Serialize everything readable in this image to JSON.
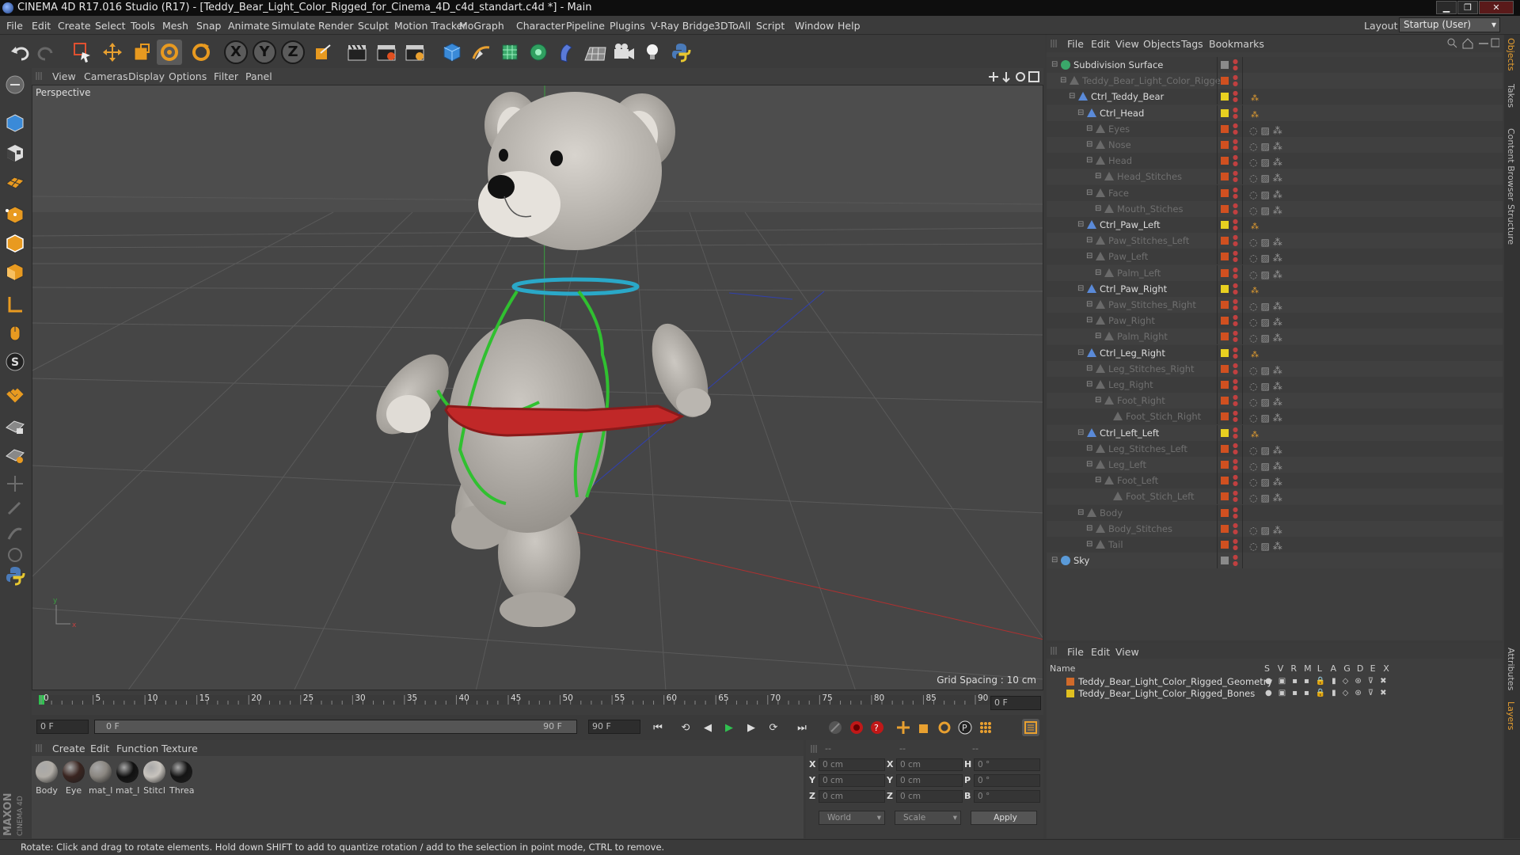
{
  "window": {
    "title": "CINEMA 4D R17.016 Studio (R17) - [Teddy_Bear_Light_Color_Rigged_for_Cinema_4D_c4d_standart.c4d *] - Main"
  },
  "menu": [
    "File",
    "Edit",
    "Create",
    "Select",
    "Tools",
    "Mesh",
    "Snap",
    "Animate",
    "Simulate",
    "Render",
    "Sculpt",
    "Motion Tracker",
    "MoGraph",
    "Character",
    "Pipeline",
    "Plugins",
    "V-Ray Bridge",
    "3DToAll",
    "Script",
    "Window",
    "Help"
  ],
  "layout": {
    "label": "Layout:",
    "value": "Startup (User)"
  },
  "toolbar": {
    "axis_x": "X",
    "axis_y": "Y",
    "axis_z": "Z"
  },
  "viewport": {
    "menu": [
      "View",
      "Cameras",
      "Display",
      "Options",
      "Filter",
      "Panel"
    ],
    "title": "Perspective",
    "grid_spacing": "Grid Spacing : 10 cm"
  },
  "timeline": {
    "ticks": [
      "0",
      "5",
      "10",
      "15",
      "20",
      "25",
      "30",
      "35",
      "40",
      "45",
      "50",
      "55",
      "60",
      "65",
      "70",
      "75",
      "80",
      "85",
      "90"
    ],
    "current_frame_box": "0 F",
    "start_field": "0 F",
    "range_start": "0 F",
    "range_end": "90 F",
    "end_field": "90 F"
  },
  "materials": {
    "menu": [
      "Create",
      "Edit",
      "Function",
      "Texture"
    ],
    "items": [
      {
        "label": "Body",
        "color": "#b0aca6"
      },
      {
        "label": "Eye",
        "color": "#3a2520"
      },
      {
        "label": "mat_l",
        "color": "#8a8680"
      },
      {
        "label": "mat_l",
        "color": "#101010"
      },
      {
        "label": "Stitcl",
        "color": "#c8c4be"
      },
      {
        "label": "Threa",
        "color": "#141414"
      }
    ]
  },
  "coords": {
    "header": [
      "--",
      "--",
      "--"
    ],
    "rows": [
      {
        "a": "X",
        "v1": "0 cm",
        "b": "X",
        "v2": "0 cm",
        "c": "H",
        "v3": "0 °"
      },
      {
        "a": "Y",
        "v1": "0 cm",
        "b": "Y",
        "v2": "0 cm",
        "c": "P",
        "v3": "0 °"
      },
      {
        "a": "Z",
        "v1": "0 cm",
        "b": "Z",
        "v2": "0 cm",
        "c": "B",
        "v3": "0 °"
      }
    ],
    "space": "World",
    "mode": "Scale",
    "apply": "Apply"
  },
  "status": "Rotate: Click and drag to rotate elements. Hold down SHIFT to add to quantize rotation / add to the selection in point mode, CTRL to remove.",
  "objects": {
    "menu": [
      "File",
      "Edit",
      "View",
      "Objects",
      "Tags",
      "Bookmarks"
    ],
    "rows": [
      {
        "name": "Subdivision Surface",
        "indent": 0,
        "dim": false,
        "dot": "#8a8a8a"
      },
      {
        "name": "Teddy_Bear_Light_Color_Rigged",
        "indent": 1,
        "dim": true,
        "dot": "#d05020"
      },
      {
        "name": "Ctrl_Teddy_Bear",
        "indent": 2,
        "dim": false,
        "dot": "#e8d020"
      },
      {
        "name": "Ctrl_Head",
        "indent": 3,
        "dim": false,
        "dot": "#e8d020"
      },
      {
        "name": "Eyes",
        "indent": 4,
        "dim": true,
        "dot": "#d05020"
      },
      {
        "name": "Nose",
        "indent": 4,
        "dim": true,
        "dot": "#d05020"
      },
      {
        "name": "Head",
        "indent": 4,
        "dim": true,
        "dot": "#d05020"
      },
      {
        "name": "Head_Stitches",
        "indent": 5,
        "dim": true,
        "dot": "#d05020"
      },
      {
        "name": "Face",
        "indent": 4,
        "dim": true,
        "dot": "#d05020"
      },
      {
        "name": "Mouth_Stiches",
        "indent": 5,
        "dim": true,
        "dot": "#d05020"
      },
      {
        "name": "Ctrl_Paw_Left",
        "indent": 3,
        "dim": false,
        "dot": "#e8d020"
      },
      {
        "name": "Paw_Stitches_Left",
        "indent": 4,
        "dim": true,
        "dot": "#d05020"
      },
      {
        "name": "Paw_Left",
        "indent": 4,
        "dim": true,
        "dot": "#d05020"
      },
      {
        "name": "Palm_Left",
        "indent": 5,
        "dim": true,
        "dot": "#d05020"
      },
      {
        "name": "Ctrl_Paw_Right",
        "indent": 3,
        "dim": false,
        "dot": "#e8d020"
      },
      {
        "name": "Paw_Stitches_Right",
        "indent": 4,
        "dim": true,
        "dot": "#d05020"
      },
      {
        "name": "Paw_Right",
        "indent": 4,
        "dim": true,
        "dot": "#d05020"
      },
      {
        "name": "Palm_Right",
        "indent": 5,
        "dim": true,
        "dot": "#d05020"
      },
      {
        "name": "Ctrl_Leg_Right",
        "indent": 3,
        "dim": false,
        "dot": "#e8d020"
      },
      {
        "name": "Leg_Stitches_Right",
        "indent": 4,
        "dim": true,
        "dot": "#d05020"
      },
      {
        "name": "Leg_Right",
        "indent": 4,
        "dim": true,
        "dot": "#d05020"
      },
      {
        "name": "Foot_Right",
        "indent": 5,
        "dim": true,
        "dot": "#d05020"
      },
      {
        "name": "Foot_Stich_Right",
        "indent": 6,
        "dim": true,
        "dot": "#d05020"
      },
      {
        "name": "Ctrl_Left_Left",
        "indent": 3,
        "dim": false,
        "dot": "#e8d020"
      },
      {
        "name": "Leg_Stitches_Left",
        "indent": 4,
        "dim": true,
        "dot": "#d05020"
      },
      {
        "name": "Leg_Left",
        "indent": 4,
        "dim": true,
        "dot": "#d05020"
      },
      {
        "name": "Foot_Left",
        "indent": 5,
        "dim": true,
        "dot": "#d05020"
      },
      {
        "name": "Foot_Stich_Left",
        "indent": 6,
        "dim": true,
        "dot": "#d05020"
      },
      {
        "name": "Body",
        "indent": 3,
        "dim": true,
        "dot": "#d05020"
      },
      {
        "name": "Body_Stitches",
        "indent": 4,
        "dim": true,
        "dot": "#d05020"
      },
      {
        "name": "Tail",
        "indent": 4,
        "dim": true,
        "dot": "#d05020"
      },
      {
        "name": "Sky",
        "indent": 0,
        "dim": false,
        "dot": "#8a8a8a"
      }
    ]
  },
  "layers": {
    "menu": [
      "File",
      "Edit",
      "View"
    ],
    "header": {
      "name": "Name",
      "cols": [
        "S",
        "V",
        "R",
        "M",
        "L",
        "A",
        "G",
        "D",
        "E",
        "X"
      ]
    },
    "rows": [
      {
        "name": "Teddy_Bear_Light_Color_Rigged_Geometry",
        "color": "#d06a2a"
      },
      {
        "name": "Teddy_Bear_Light_Color_Rigged_Bones",
        "color": "#e0c020"
      }
    ]
  },
  "side_tabs": [
    "Objects",
    "Takes",
    "Content Browser",
    "Structure",
    "Attributes",
    "Layers"
  ],
  "brand": {
    "maxon": "MAXON",
    "c4d": "CINEMA 4D"
  }
}
